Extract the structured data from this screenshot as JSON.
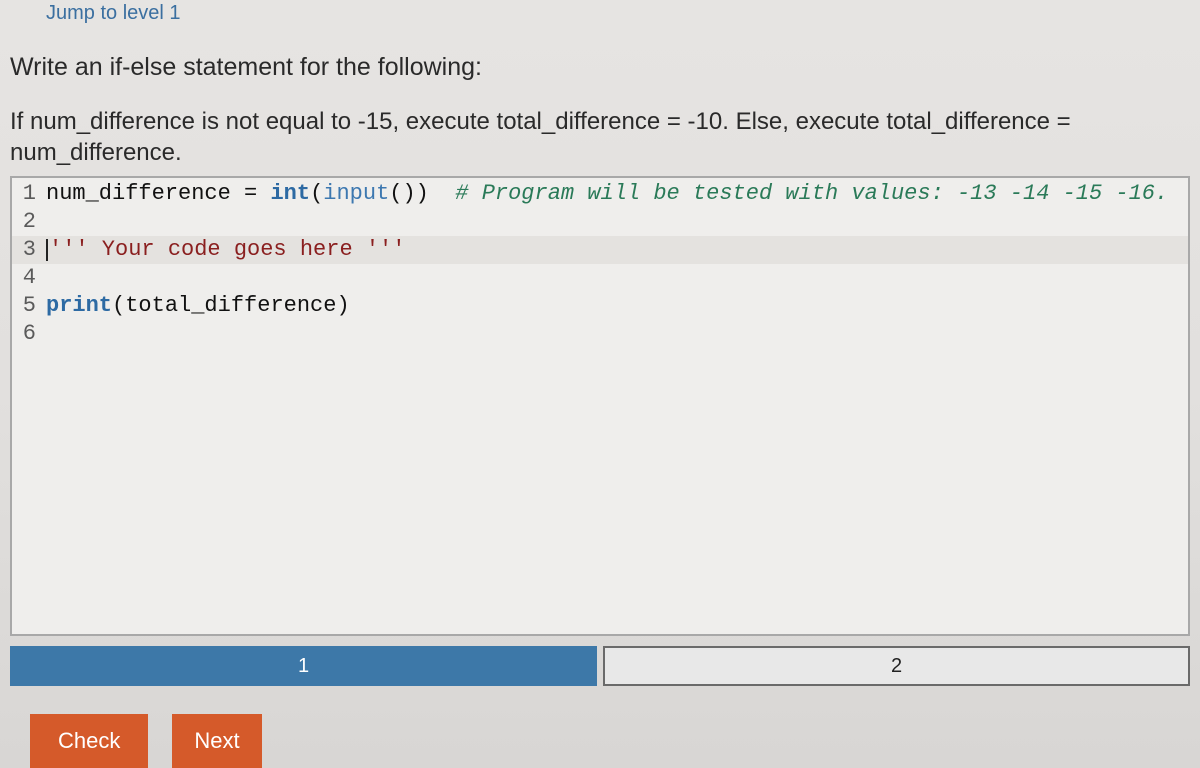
{
  "header": {
    "jump_link": "Jump to level 1"
  },
  "instructions": {
    "title": "Write an if-else statement for the following:",
    "body_parts": {
      "p1": "If num_difference is not equal to -15, execute total_difference = -10. Else, execute total_difference = num_difference."
    }
  },
  "code": {
    "lines": [
      {
        "n": "1",
        "segments": [
          {
            "t": "num_difference ",
            "c": "tk-name"
          },
          {
            "t": "=",
            "c": "tk-name"
          },
          {
            "t": " ",
            "c": ""
          },
          {
            "t": "int",
            "c": "tk-builtin"
          },
          {
            "t": "(",
            "c": "tk-name"
          },
          {
            "t": "input",
            "c": "tk-func"
          },
          {
            "t": "())  ",
            "c": "tk-name"
          },
          {
            "t": "# Program will be tested with values: -13 -14 -15 -16.",
            "c": "tk-comment"
          }
        ]
      },
      {
        "n": "2",
        "segments": []
      },
      {
        "n": "3",
        "cursor": true,
        "segments": [
          {
            "t": "''' Your code goes here '''",
            "c": "tk-string"
          }
        ]
      },
      {
        "n": "4",
        "segments": []
      },
      {
        "n": "5",
        "segments": [
          {
            "t": "print",
            "c": "tk-builtin"
          },
          {
            "t": "(total_difference)",
            "c": "tk-name"
          }
        ]
      },
      {
        "n": "6",
        "segments": []
      }
    ]
  },
  "tabs": {
    "items": [
      {
        "label": "1",
        "active": true
      },
      {
        "label": "2",
        "active": false
      }
    ]
  },
  "buttons": {
    "check": "Check",
    "next": "Next"
  }
}
